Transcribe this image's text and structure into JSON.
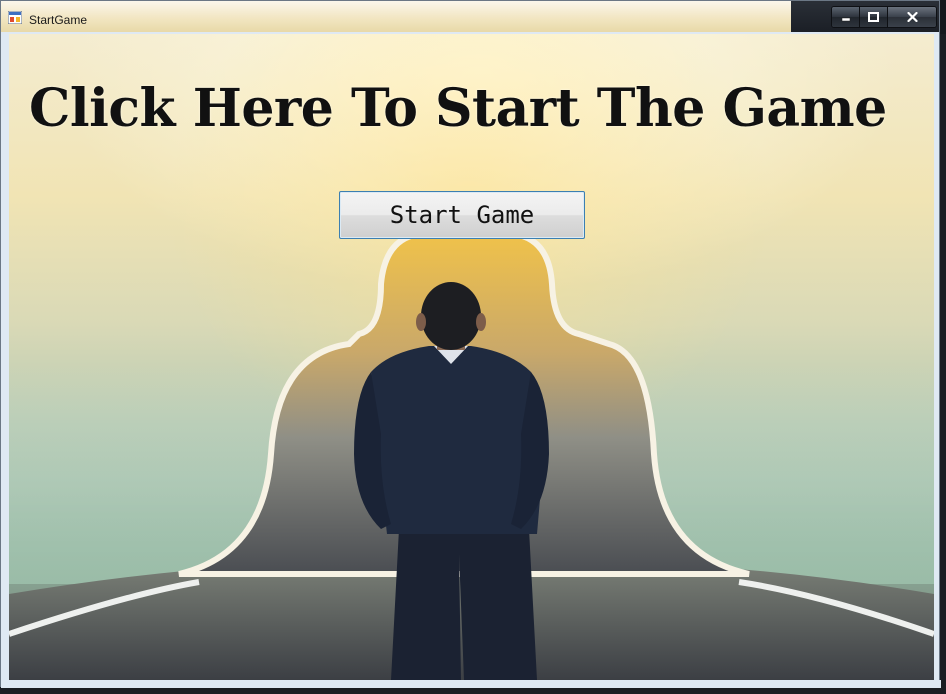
{
  "window": {
    "title": "StartGame",
    "controls": {
      "minimize": "minimize-icon",
      "maximize": "maximize-icon",
      "close": "close-icon"
    }
  },
  "main": {
    "headline": "Click Here To Start The Game",
    "start_button_label": "Start Game"
  },
  "colors": {
    "headline": "#111111",
    "button_border": "#3c7fb1",
    "suit": "#1f2a3f"
  }
}
